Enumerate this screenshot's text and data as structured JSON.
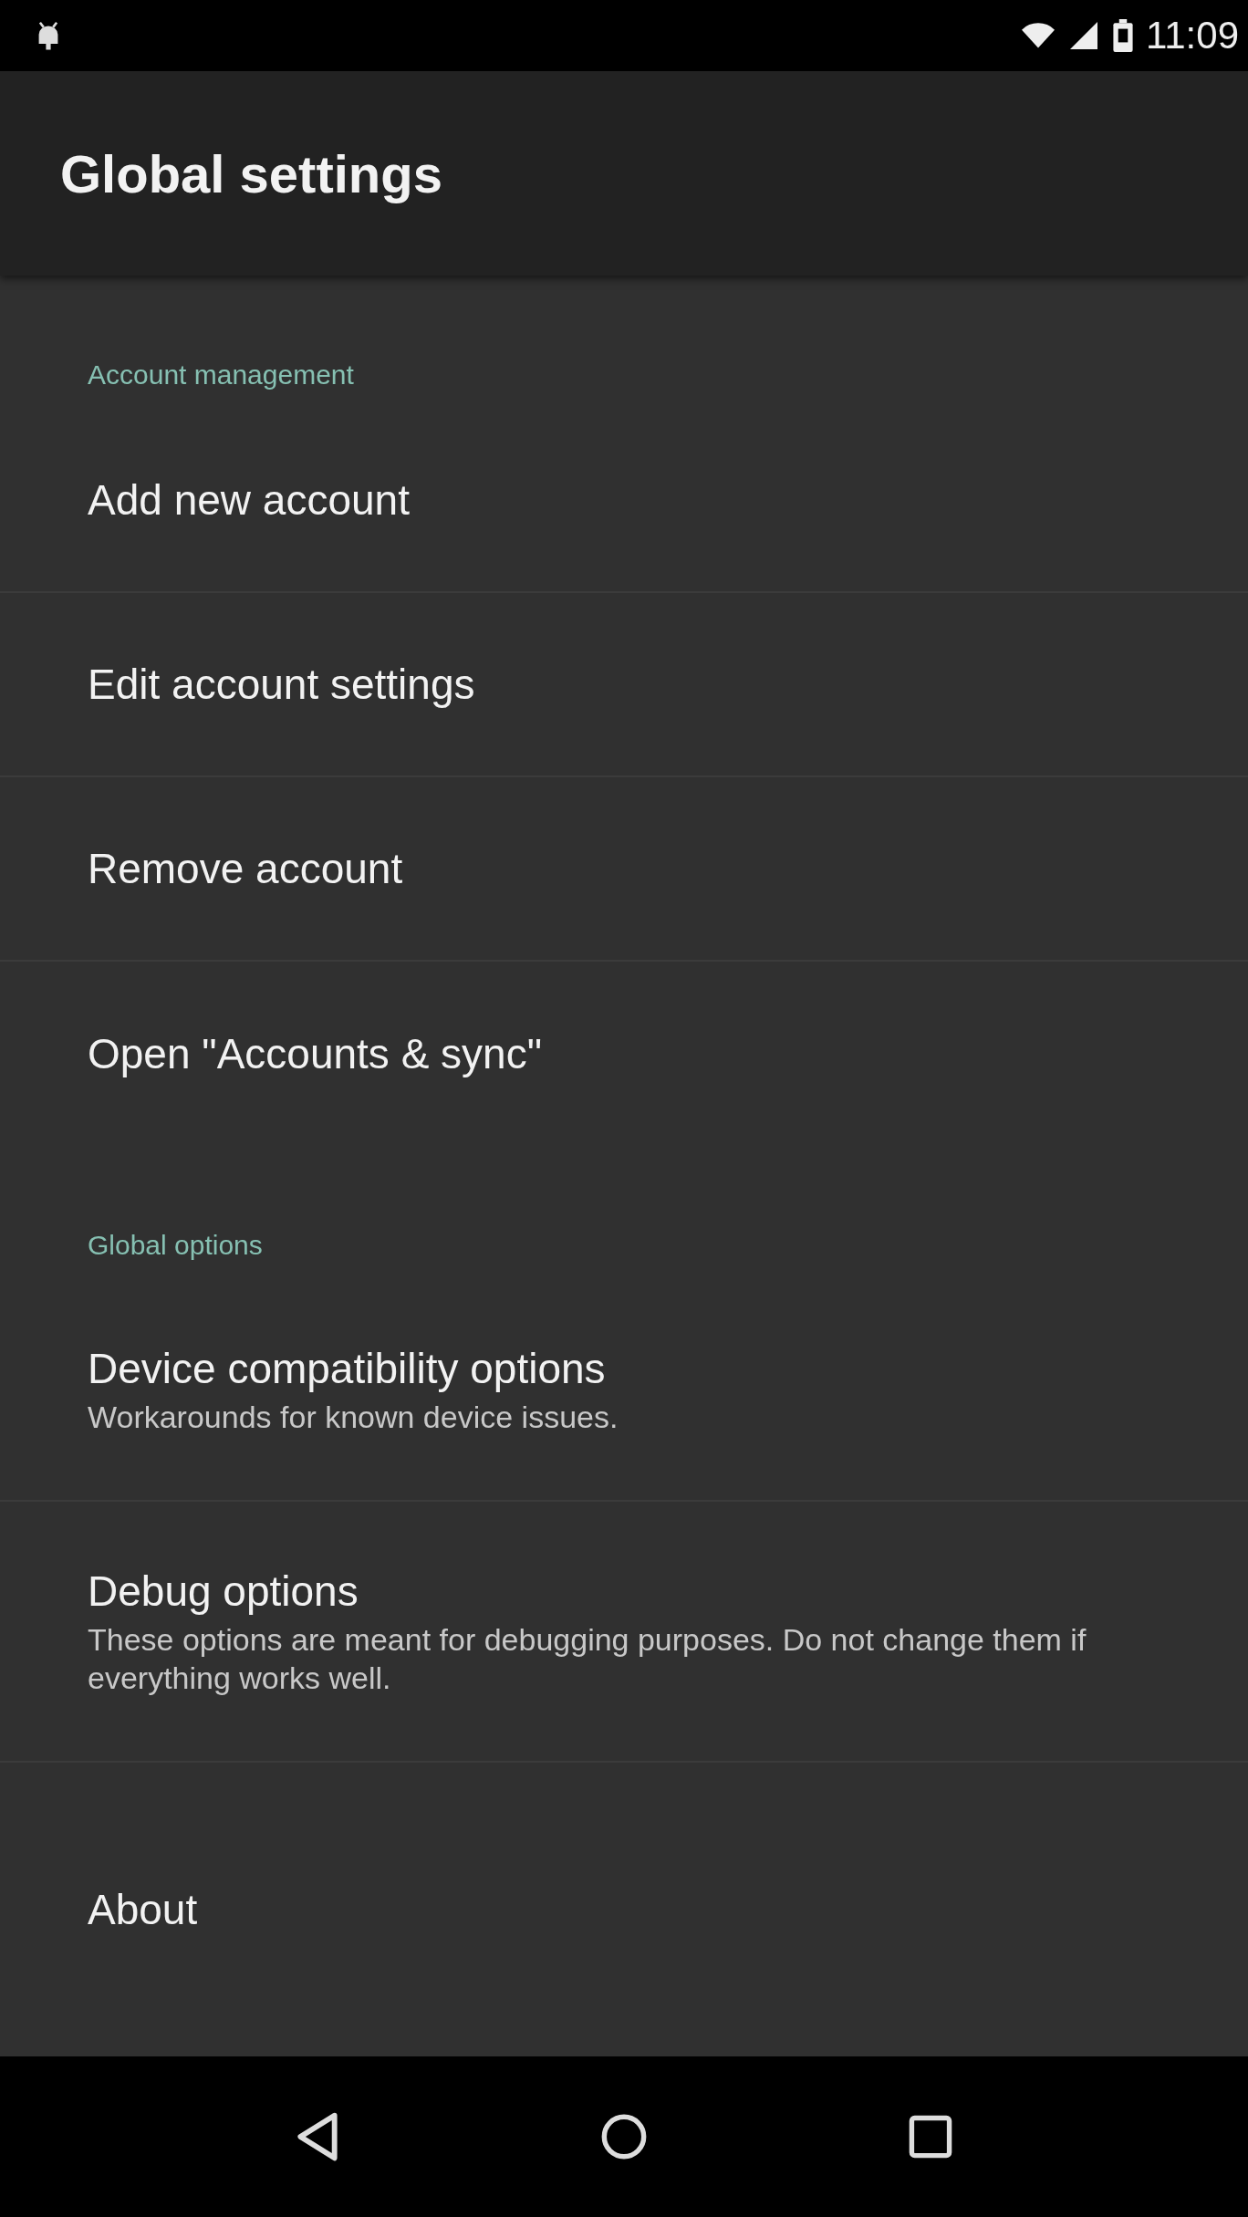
{
  "status_bar": {
    "time": "11:09"
  },
  "app_bar": {
    "title": "Global settings"
  },
  "sections": [
    {
      "header": "Account management",
      "items": [
        {
          "title": "Add new account"
        },
        {
          "title": "Edit account settings"
        },
        {
          "title": "Remove account"
        },
        {
          "title": "Open \"Accounts & sync\""
        }
      ]
    },
    {
      "header": "Global options",
      "items": [
        {
          "title": "Device compatibility options",
          "summary": "Workarounds for known device issues."
        },
        {
          "title": "Debug options",
          "summary": "These options are meant for debugging purposes. Do not change them if everything works well."
        },
        {
          "title": "About"
        }
      ]
    }
  ]
}
